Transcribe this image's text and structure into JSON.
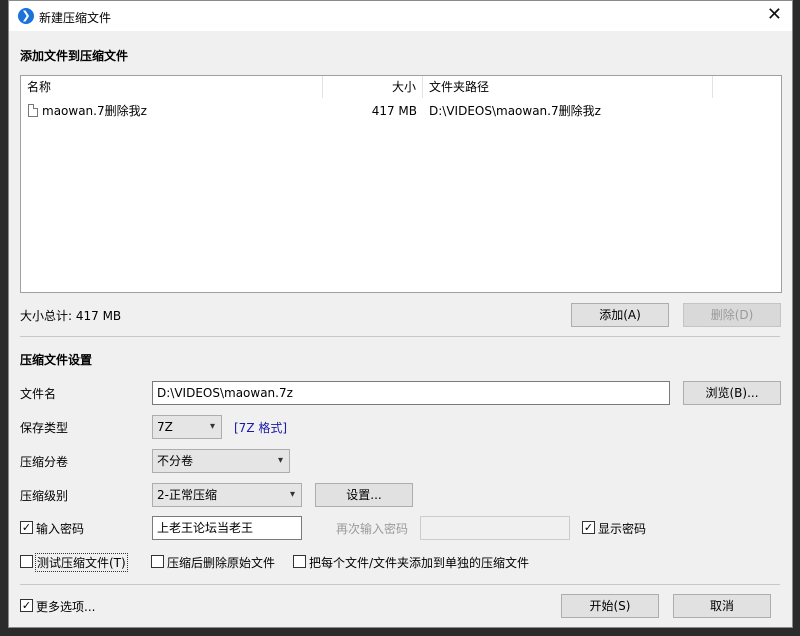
{
  "window": {
    "title": "新建压缩文件",
    "app_icon_glyph": "❯",
    "close_glyph": "✕"
  },
  "add_files_section": {
    "title": "添加文件到压缩文件",
    "columns": [
      "名称",
      "大小",
      "文件夹路径"
    ],
    "files": [
      {
        "name": "maowan.7删除我z",
        "size": "417 MB",
        "path": "D:\\VIDEOS\\maowan.7删除我z"
      }
    ],
    "total_size_label": "大小总计: 417 MB",
    "add_button": "添加(A)",
    "delete_button": "删除(D)"
  },
  "settings_section": {
    "title": "压缩文件设置",
    "filename_label": "文件名",
    "filename_value": "D:\\VIDEOS\\maowan.7z",
    "browse_button": "浏览(B)...",
    "save_type_label": "保存类型",
    "save_type_value": "7Z",
    "save_type_link": "[7Z 格式]",
    "volume_label": "压缩分卷",
    "volume_value": "不分卷",
    "level_label": "压缩级别",
    "level_value": "2-正常压缩",
    "settings_button": "设置...",
    "password_checkbox_label": "输入密码",
    "password_checked": true,
    "password_value": "上老王论坛当老王",
    "reenter_password_label": "再次输入密码",
    "reenter_password_value": "",
    "show_password_label": "显示密码",
    "show_password_checked": true,
    "test_archive_label": "测试压缩文件(T)",
    "test_archive_checked": false,
    "delete_source_label": "压缩后删除原始文件",
    "delete_source_checked": false,
    "separate_archives_label": "把每个文件/文件夹添加到单独的压缩文件",
    "separate_archives_checked": false
  },
  "footer": {
    "more_options_label": "更多选项...",
    "more_options_checked": true,
    "start_button": "开始(S)",
    "cancel_button": "取消"
  },
  "check_glyph": "✓"
}
